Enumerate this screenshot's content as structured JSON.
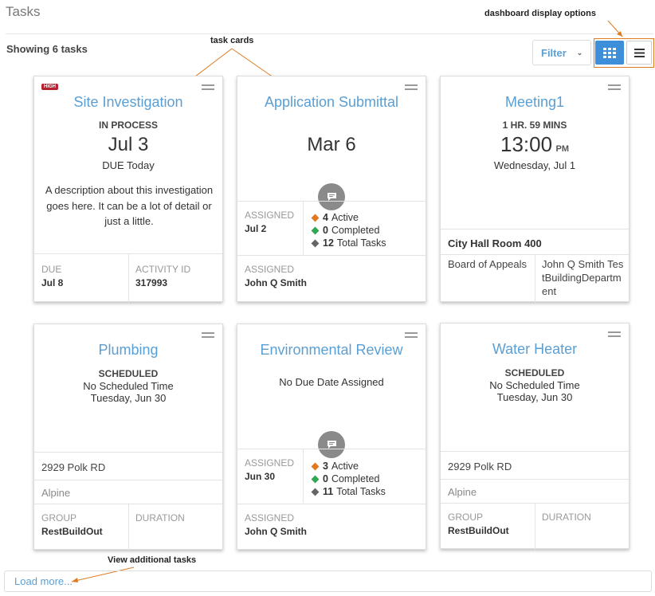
{
  "page": {
    "title": "Tasks",
    "showing": "Showing 6 tasks",
    "load_more": "Load more..."
  },
  "toolbar": {
    "filter_label": "Filter",
    "view_grid": "grid-view-icon",
    "view_list": "list-view-icon"
  },
  "annotations": {
    "task_cards": "task cards",
    "display_options": "dashboard display options",
    "view_more": "View additional tasks"
  },
  "colors": {
    "accent": "#3d8fd9",
    "link": "#5a9fd4",
    "annotation": "#e07a1f",
    "high": "#b5222f",
    "active": "#e07a1f",
    "completed": "#2fa84f",
    "total": "#666666"
  },
  "cards": [
    {
      "title": "Site Investigation",
      "badge": "HIGH",
      "status": "IN PROCESS",
      "date": "Jul 3",
      "due_text": "DUE Today",
      "description": "A description about this investigation goes here. It can be a lot of detail or just a little.",
      "left_label": "DUE",
      "left_value": "Jul 8",
      "right_label": "ACTIVITY ID",
      "right_value": "317993"
    },
    {
      "title": "Application Submittal",
      "date": "Mar 6",
      "assigned_label": "ASSIGNED",
      "assigned_date": "Jul 2",
      "active_count": "4",
      "active_label": "Active",
      "completed_count": "0",
      "completed_label": "Completed",
      "total_count": "12",
      "total_label": "Total Tasks",
      "footer_label": "ASSIGNED",
      "footer_value": "John Q Smith"
    },
    {
      "title": "Meeting1",
      "duration": "1 HR. 59 MINS",
      "time": "13:00",
      "ampm": "PM",
      "day": "Wednesday, Jul 1",
      "location": "City Hall Room 400",
      "left_text": "Board of Appeals",
      "right_text": "John Q Smith TestBuildingDepartment"
    },
    {
      "title": "Plumbing",
      "status": "SCHEDULED",
      "time_text": "No Scheduled Time",
      "day": "Tuesday, Jun 30",
      "address": "2929 Polk RD",
      "city": "Alpine",
      "left_label": "GROUP",
      "left_value": "RestBuildOut",
      "right_label": "DURATION"
    },
    {
      "title": "Environmental Review",
      "due_text": "No Due Date Assigned",
      "assigned_label": "ASSIGNED",
      "assigned_date": "Jun 30",
      "active_count": "3",
      "active_label": "Active",
      "completed_count": "0",
      "completed_label": "Completed",
      "total_count": "11",
      "total_label": "Total Tasks",
      "footer_label": "ASSIGNED",
      "footer_value": "John Q Smith"
    },
    {
      "title": "Water Heater",
      "status": "SCHEDULED",
      "time_text": "No Scheduled Time",
      "day": "Tuesday, Jun 30",
      "address": "2929 Polk RD",
      "city": "Alpine",
      "left_label": "GROUP",
      "left_value": "RestBuildOut",
      "right_label": "DURATION"
    }
  ]
}
